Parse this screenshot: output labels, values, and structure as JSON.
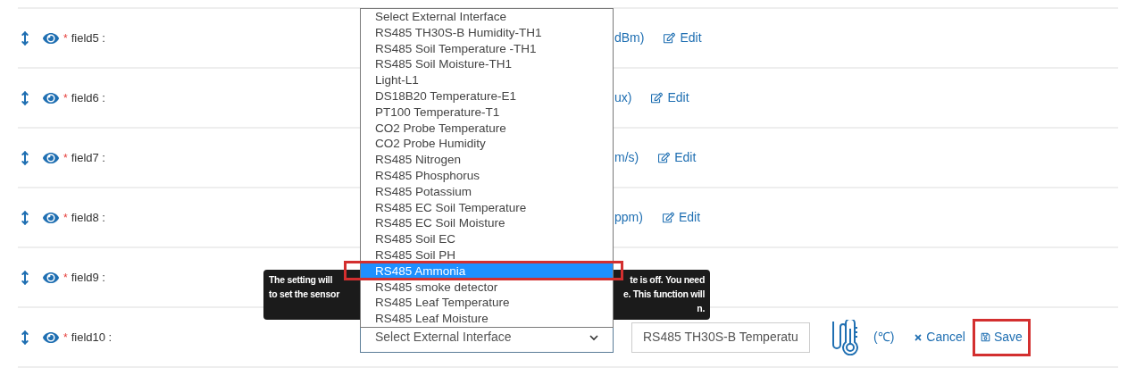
{
  "fields": [
    {
      "label": "field5 :",
      "required": true,
      "marker": "*",
      "unit": "dBm)",
      "action": "Edit"
    },
    {
      "label": "field6 :",
      "required": true,
      "marker": "*",
      "unit": "ux)",
      "action": "Edit"
    },
    {
      "label": "field7 :",
      "required": true,
      "marker": "*",
      "unit": "m/s)",
      "action": "Edit"
    },
    {
      "label": "field8 :",
      "required": true,
      "marker": "*",
      "unit": "ppm)",
      "action": "Edit"
    },
    {
      "label": "field9 :",
      "required": true,
      "marker": "*"
    },
    {
      "label": "field10 :",
      "required": true,
      "marker": "*"
    }
  ],
  "editor": {
    "select": "Select External Interface",
    "value": "RS485 TH30S-B Temperatu",
    "unit": "(℃)",
    "cancel": "Cancel",
    "save": "Save",
    "save_framed": true
  },
  "dropdown": {
    "options": [
      {
        "label": "Select External Interface",
        "selected": false
      },
      {
        "label": "RS485 TH30S-B Humidity-TH1",
        "selected": false
      },
      {
        "label": "RS485 Soil Temperature -TH1",
        "selected": false
      },
      {
        "label": "RS485 Soil Moisture-TH1",
        "selected": false
      },
      {
        "label": "Light-L1",
        "selected": false
      },
      {
        "label": "DS18B20 Temperature-E1",
        "selected": false
      },
      {
        "label": "PT100 Temperature-T1",
        "selected": false
      },
      {
        "label": "CO2 Probe Temperature",
        "selected": false
      },
      {
        "label": "CO2 Probe Humidity",
        "selected": false
      },
      {
        "label": "RS485 Nitrogen",
        "selected": false
      },
      {
        "label": "RS485 Phosphorus",
        "selected": false
      },
      {
        "label": "RS485 Potassium",
        "selected": false
      },
      {
        "label": "RS485 EC Soil Temperature",
        "selected": false
      },
      {
        "label": "RS485 EC Soil Moisture",
        "selected": false
      },
      {
        "label": "RS485 Soil EC",
        "selected": false
      },
      {
        "label": "RS485 Soil PH",
        "selected": false
      },
      {
        "label": "RS485 Ammonia",
        "selected": true
      },
      {
        "label": "RS485 smoke detector",
        "selected": false
      },
      {
        "label": "RS485 Leaf Temperature",
        "selected": false
      },
      {
        "label": "RS485 Leaf Moisture",
        "selected": false
      }
    ]
  },
  "tooltip": {
    "lines": [
      {
        "left": "The setting will",
        "right": "te is off. You need"
      },
      {
        "left": "to set the sensor",
        "right": "e. This function will"
      },
      {
        "right": "n."
      }
    ]
  }
}
